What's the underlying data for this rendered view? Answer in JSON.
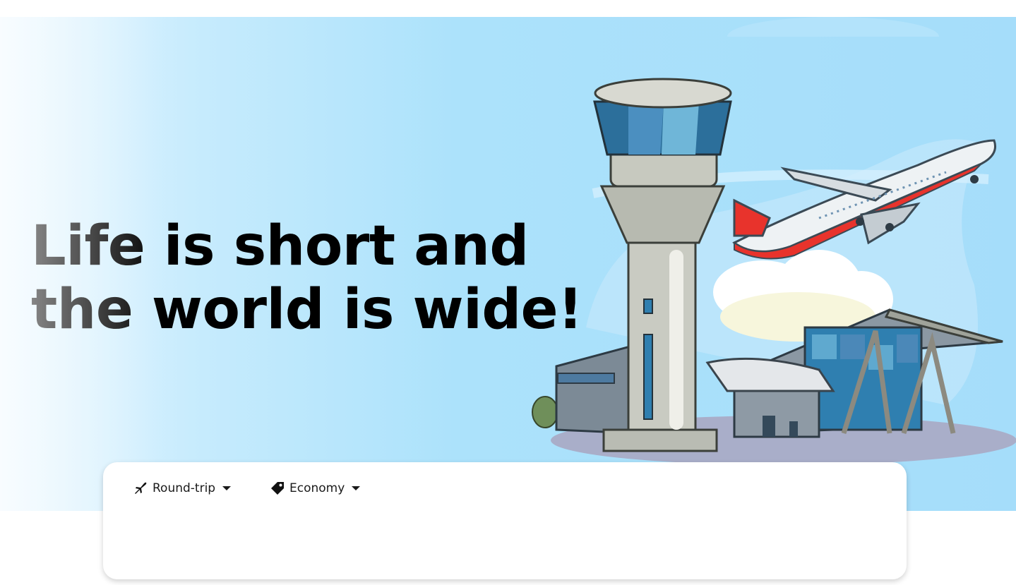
{
  "hero": {
    "headline_line1": "Life is short and",
    "headline_line2": "the world is wide!",
    "illustration": "airport-control-tower-and-departing-airplane"
  },
  "search": {
    "trip_type": {
      "icon": "airplane-icon",
      "label": "Round-trip"
    },
    "cabin_class": {
      "icon": "tag-icon",
      "label": "Economy"
    }
  },
  "colors": {
    "hero_sky": "#a5ddfa",
    "hero_fade": "#eaf7ff",
    "headline_text": "#000000",
    "plane_accent": "#e8332c",
    "card_background": "#ffffff"
  }
}
